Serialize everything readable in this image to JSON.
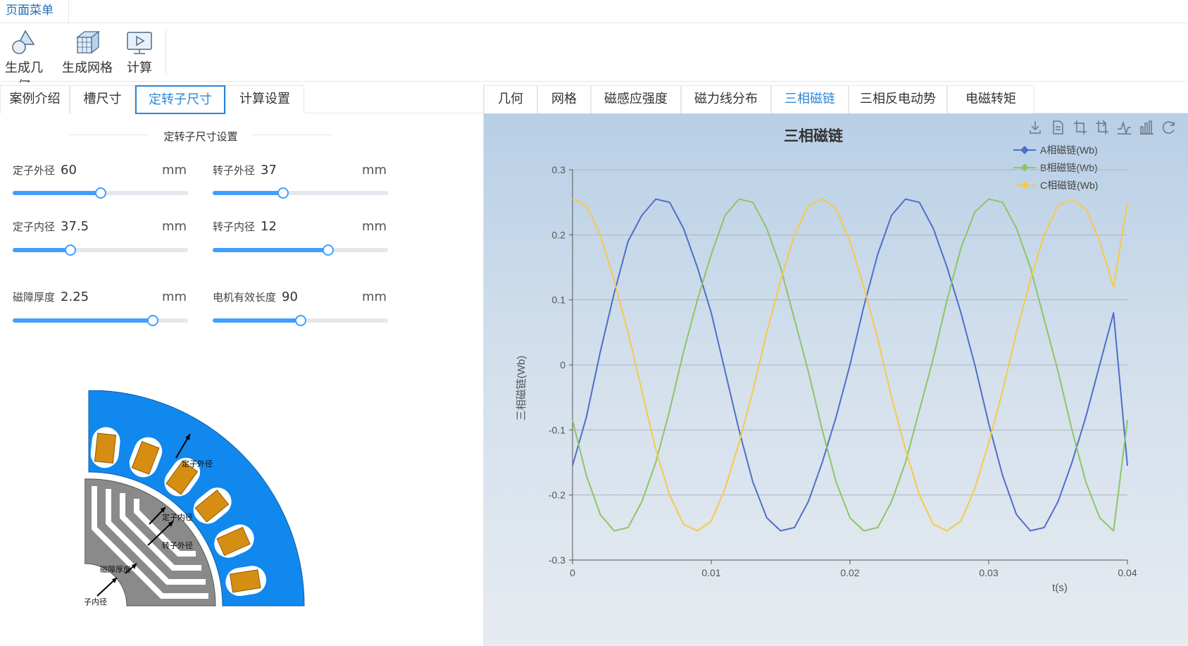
{
  "menu": {
    "tab": "页面菜单"
  },
  "toolbar": {
    "items": [
      {
        "label": "生成几何",
        "icon": "geometry-icon"
      },
      {
        "label": "生成网格",
        "icon": "mesh-cube-icon"
      },
      {
        "label": "计算",
        "icon": "compute-monitor-icon"
      }
    ]
  },
  "left": {
    "tabs": [
      "案例介绍",
      "槽尺寸",
      "定转子尺寸",
      "计算设置"
    ],
    "active_tab": "定转子尺寸",
    "section_title": "定转子尺寸设置",
    "params": [
      {
        "label": "定子外径",
        "value": "60",
        "unit": "mm",
        "fraction": 0.5
      },
      {
        "label": "转子外径",
        "value": "37",
        "unit": "mm",
        "fraction": 0.4
      },
      {
        "label": "定子内径",
        "value": "37.5",
        "unit": "mm",
        "fraction": 0.33
      },
      {
        "label": "转子内径",
        "value": "12",
        "unit": "mm",
        "fraction": 0.66
      },
      {
        "label": "磁障厚度",
        "value": "2.25",
        "unit": "mm",
        "fraction": 0.8
      },
      {
        "label": "电机有效长度",
        "value": "90",
        "unit": "mm",
        "fraction": 0.5
      }
    ],
    "diagram_labels": {
      "stator_outer": "定子外径",
      "stator_inner": "定子内径",
      "rotor_outer": "转子外径",
      "barrier": "磁障厚度",
      "rotor_inner": "转子内径"
    }
  },
  "right": {
    "tabs": [
      "几何",
      "网格",
      "磁感应强度",
      "磁力线分布",
      "三相磁链",
      "三相反电动势",
      "电磁转矩"
    ],
    "active_tab": "三相磁链",
    "toolbox_icons": [
      "download-icon",
      "data-view-icon",
      "zoom-icon",
      "zoom-reset-icon",
      "line-chart-icon",
      "bar-chart-icon",
      "restore-icon"
    ]
  },
  "chart_data": {
    "type": "line",
    "title": "三相磁链",
    "xlabel": "t(s)",
    "ylabel": "三相磁链(Wb)",
    "xlim": [
      0,
      0.04
    ],
    "ylim": [
      -0.3,
      0.3
    ],
    "xticks": [
      "0",
      "0.01",
      "0.02",
      "0.03",
      "0.04"
    ],
    "yticks": [
      "-0.3",
      "-0.2",
      "-0.1",
      "0",
      "0.1",
      "0.2",
      "0.3"
    ],
    "grid": true,
    "legend_position": "top-right",
    "x": [
      0,
      0.001,
      0.002,
      0.003,
      0.004,
      0.005,
      0.006,
      0.007,
      0.008,
      0.009,
      0.01,
      0.011,
      0.012,
      0.013,
      0.014,
      0.015,
      0.016,
      0.017,
      0.018,
      0.019,
      0.02,
      0.021,
      0.022,
      0.023,
      0.024,
      0.025,
      0.026,
      0.027,
      0.028,
      0.029,
      0.03,
      0.031,
      0.032,
      0.033,
      0.034,
      0.035,
      0.036,
      0.037,
      0.038,
      0.039,
      0.04
    ],
    "series": [
      {
        "name": "A相磁链(Wb)",
        "color": "#4e6fc9",
        "values": [
          -0.155,
          -0.08,
          0.02,
          0.11,
          0.19,
          0.23,
          0.255,
          0.25,
          0.21,
          0.15,
          0.08,
          -0.01,
          -0.1,
          -0.18,
          -0.235,
          -0.255,
          -0.25,
          -0.21,
          -0.15,
          -0.08,
          0.0,
          0.09,
          0.17,
          0.23,
          0.255,
          0.25,
          0.21,
          0.15,
          0.08,
          0.0,
          -0.09,
          -0.17,
          -0.23,
          -0.255,
          -0.25,
          -0.21,
          -0.15,
          -0.08,
          0.0,
          0.08,
          -0.155
        ]
      },
      {
        "name": "B相磁链(Wb)",
        "color": "#8cc665",
        "values": [
          -0.085,
          -0.17,
          -0.23,
          -0.255,
          -0.25,
          -0.21,
          -0.15,
          -0.07,
          0.02,
          0.1,
          0.17,
          0.23,
          0.255,
          0.25,
          0.21,
          0.15,
          0.07,
          -0.01,
          -0.1,
          -0.18,
          -0.235,
          -0.255,
          -0.25,
          -0.21,
          -0.15,
          -0.07,
          0.01,
          0.1,
          0.18,
          0.235,
          0.255,
          0.25,
          0.21,
          0.15,
          0.07,
          -0.01,
          -0.1,
          -0.18,
          -0.235,
          -0.255,
          -0.085
        ]
      },
      {
        "name": "C相磁链(Wb)",
        "color": "#f7c948",
        "values": [
          0.255,
          0.245,
          0.2,
          0.13,
          0.05,
          -0.04,
          -0.13,
          -0.2,
          -0.245,
          -0.255,
          -0.24,
          -0.19,
          -0.12,
          -0.04,
          0.05,
          0.13,
          0.2,
          0.245,
          0.255,
          0.24,
          0.19,
          0.12,
          0.04,
          -0.05,
          -0.13,
          -0.2,
          -0.245,
          -0.255,
          -0.24,
          -0.19,
          -0.12,
          -0.04,
          0.05,
          0.13,
          0.2,
          0.245,
          0.255,
          0.24,
          0.19,
          0.12,
          0.25
        ]
      }
    ]
  }
}
